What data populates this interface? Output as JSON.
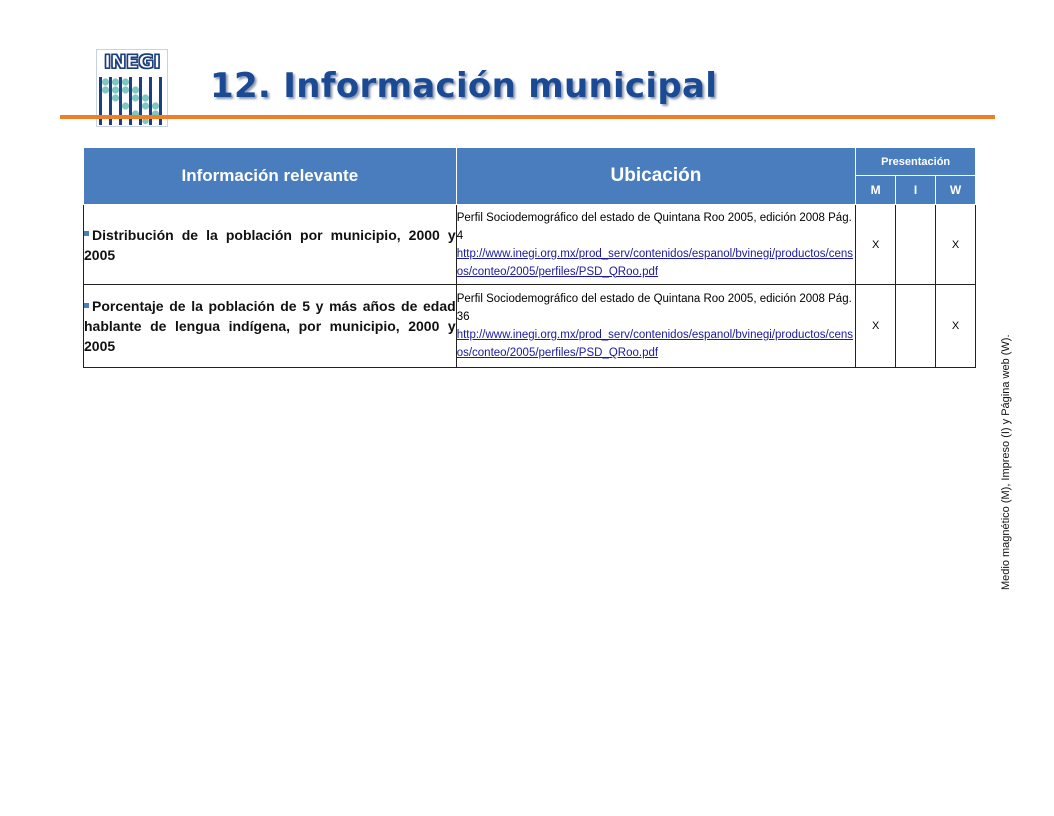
{
  "logo": {
    "text": "INEGI"
  },
  "title": "12. Información municipal",
  "table": {
    "headers": {
      "info": "Información  relevante",
      "ubicacion": "Ubicación",
      "presentacion": "Presentación",
      "m": "M",
      "i": "I",
      "w": "W"
    },
    "rows": [
      {
        "info": "Distribución de la población por municipio, 2000 y 2005",
        "source": "Perfil Sociodemográfico del estado de Quintana Roo 2005, edición 2008   Pág. 4",
        "url": "http://www.inegi.org.mx/prod_serv/contenidos/espanol/bvinegi/productos/censos/conteo/2005/perfiles/PSD_QRoo.pdf",
        "m": "X",
        "i": "",
        "w": "X"
      },
      {
        "info": "Porcentaje de la población de 5 y más años de edad hablante de lengua indígena, por municipio, 2000 y 2005",
        "source": "Perfil Sociodemográfico del estado de Quintana Roo 2005, edición 2008   Pág. 36",
        "url": "http://www.inegi.org.mx/prod_serv/contenidos/espanol/bvinegi/productos/censos/conteo/2005/perfiles/PSD_QRoo.pdf",
        "m": "X",
        "i": "",
        "w": "X"
      }
    ]
  },
  "side_note": "Medio magnético (M), Impreso (I) y Página web (W).",
  "colors": {
    "header_bg": "#4a7dbe",
    "title": "#1b4a94",
    "rule": "#ef7f24"
  }
}
